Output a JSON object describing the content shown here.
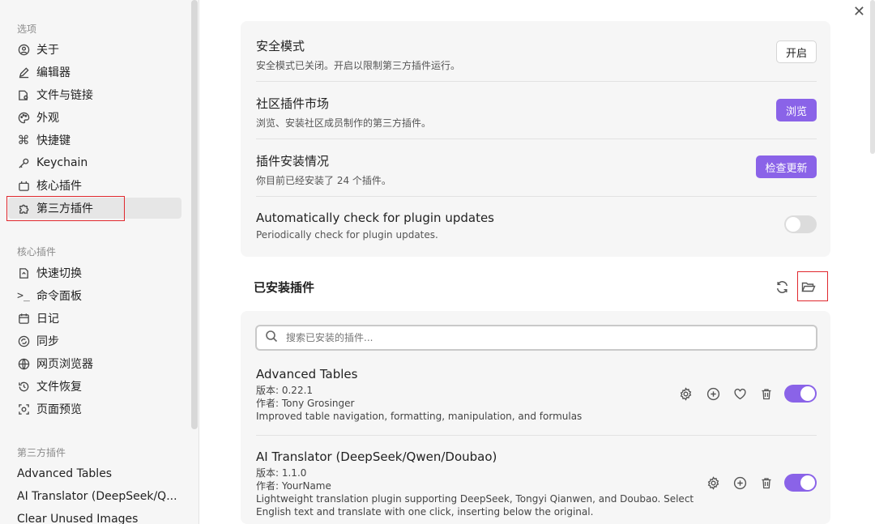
{
  "sidebar": {
    "options_header": "选项",
    "options": [
      {
        "label": "关于",
        "icon": "user-circle-icon"
      },
      {
        "label": "编辑器",
        "icon": "pencil-icon"
      },
      {
        "label": "文件与链接",
        "icon": "file-link-icon"
      },
      {
        "label": "外观",
        "icon": "palette-icon"
      },
      {
        "label": "快捷键",
        "icon": "command-icon"
      },
      {
        "label": "Keychain",
        "icon": "key-icon"
      },
      {
        "label": "核心插件",
        "icon": "plug-icon"
      },
      {
        "label": "第三方插件",
        "icon": "puzzle-icon"
      }
    ],
    "core_header": "核心插件",
    "core": [
      {
        "label": "快速切换",
        "icon": "quick-switch-icon"
      },
      {
        "label": "命令面板",
        "icon": "terminal-icon"
      },
      {
        "label": "日记",
        "icon": "calendar-icon"
      },
      {
        "label": "同步",
        "icon": "sync-icon"
      },
      {
        "label": "网页浏览器",
        "icon": "globe-icon"
      },
      {
        "label": "文件恢复",
        "icon": "history-icon"
      },
      {
        "label": "页面预览",
        "icon": "preview-icon"
      }
    ],
    "third_header": "第三方插件",
    "third": [
      "Advanced Tables",
      "AI Translator (DeepSeek/Q...",
      "Clear Unused Images"
    ]
  },
  "settings": {
    "safe_mode": {
      "title": "安全模式",
      "desc": "安全模式已关闭。开启以限制第三方插件运行。",
      "button": "开启"
    },
    "community": {
      "title": "社区插件市场",
      "desc": "浏览、安装社区成员制作的第三方插件。",
      "button": "浏览"
    },
    "installed_status": {
      "title": "插件安装情况",
      "desc": "你目前已经安装了 24 个插件。",
      "button": "检查更新"
    },
    "auto_check": {
      "title": "Automatically check for plugin updates",
      "desc": "Periodically check for plugin updates.",
      "enabled": false
    }
  },
  "installed": {
    "header": "已安装插件",
    "search_placeholder": "搜索已安装的插件...",
    "plugins": [
      {
        "name": "Advanced Tables",
        "version": "版本: 0.22.1",
        "author": "作者: Tony Grosinger",
        "desc": "Improved table navigation, formatting, manipulation, and formulas",
        "enabled": true
      },
      {
        "name": "AI Translator (DeepSeek/Qwen/Doubao)",
        "version": "版本: 1.1.0",
        "author": "作者: YourName",
        "desc1": "Lightweight translation plugin supporting DeepSeek, Tongyi Qianwen, and Doubao. Select",
        "desc2": "English text and translate with one click, inserting below the original.",
        "enabled": true
      }
    ]
  },
  "colors": {
    "accent": "#8a63e8",
    "highlight": "#e0282e"
  }
}
